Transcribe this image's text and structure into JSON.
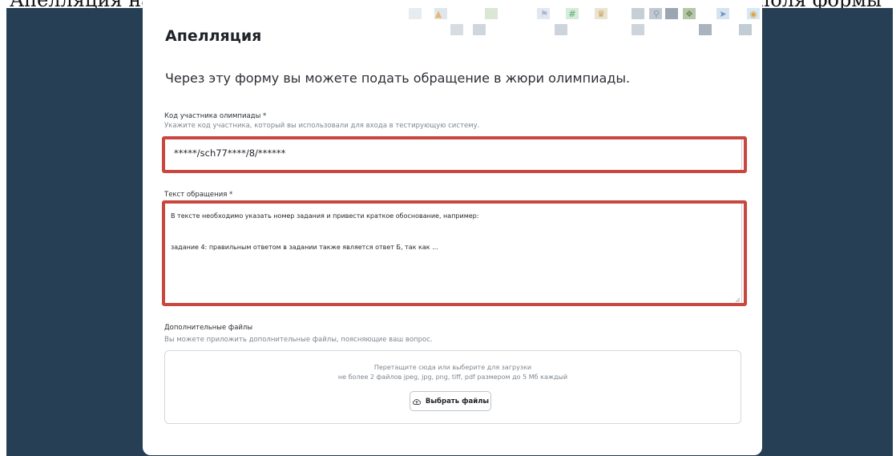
{
  "top_strip": {
    "text": "Апелляция на результаты олимпиады подаётся через форму. Заполните поля формы"
  },
  "form": {
    "title": "Апелляция",
    "intro": "Через эту форму вы можете подать обращение в жюри олимпиады.",
    "participant_code": {
      "label": "Код участника олимпиады *",
      "hint": "Укажите код участника, который вы использовали для входа в тестирующую систему.",
      "value": "*****/sch77****/8/******"
    },
    "appeal_text": {
      "label": "Текст обращения *",
      "lines": [
        "В тексте необходимо указать номер задания и привести краткое обоснование, например:",
        "задание 4: правильным ответом в задании также является ответ Б, так как ..."
      ]
    },
    "attachments": {
      "label": "Дополнительные файлы",
      "hint": "Вы можете приложить дополнительные файлы, поясняющие ваш вопрос.",
      "drop_text": "Перетащите сюда или выберите для загрузки",
      "limits_text": "не более 2 файлов jpeg, jpg, png, tiff, pdf размером до 5 Мб каждый",
      "button_label": "Выбрать файлы",
      "button_icon": "cloud-upload-icon"
    }
  },
  "colors": {
    "backdrop": "#263f55",
    "highlight": "#c9473f",
    "card": "#ffffff"
  },
  "mosaic_icons": [
    "bell-icon",
    "flag-icon",
    "hash-icon",
    "crown-icon",
    "search-icon",
    "puzzle-icon",
    "cursor-icon",
    "eye-icon"
  ]
}
